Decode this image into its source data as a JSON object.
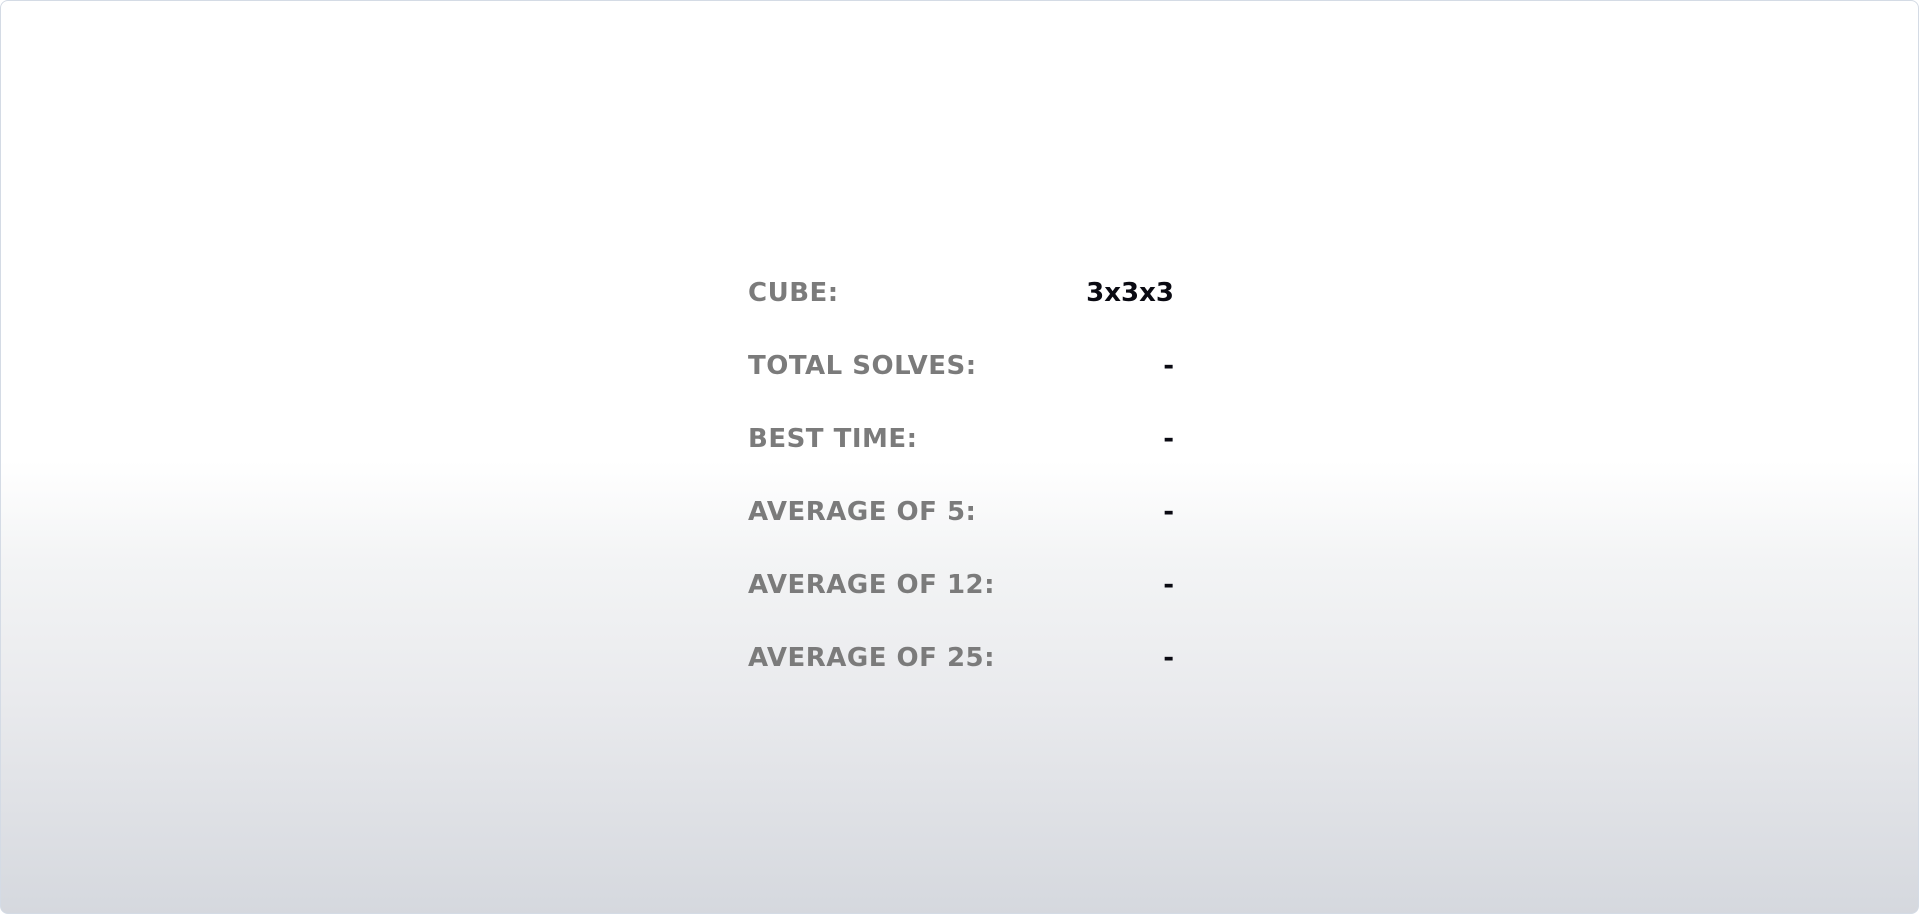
{
  "stats": {
    "cube_label": "CUBE:",
    "cube_value": "3x3x3",
    "total_solves_label": "TOTAL SOLVES:",
    "total_solves_value": "-",
    "best_time_label": "BEST TIME:",
    "best_time_value": "-",
    "ao5_label": "AVERAGE OF 5:",
    "ao5_value": "-",
    "ao12_label": "AVERAGE OF 12:",
    "ao12_value": "-",
    "ao25_label": "AVERAGE OF 25:",
    "ao25_value": "-"
  }
}
